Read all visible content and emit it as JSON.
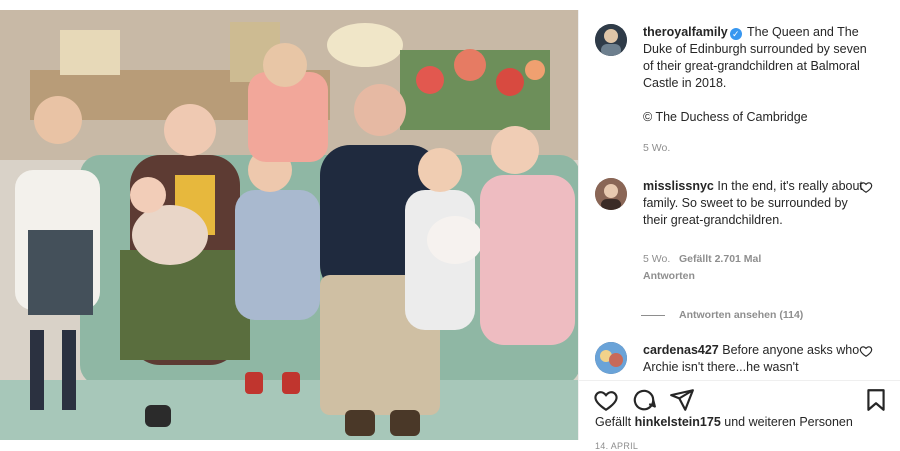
{
  "post": {
    "image_alt": "Family photo",
    "caption": {
      "username": "theroyalfamily",
      "text": "The Queen and The Duke of Edinburgh surrounded by seven of their great-grandchildren at Balmoral Castle in 2018.",
      "credit": "© The Duchess of Cambridge",
      "age": "5 Wo."
    },
    "comments": [
      {
        "username": "misslissnyc",
        "text": "In the end, it's really about family. So sweet to be surrounded by their great-grandchildren.",
        "age": "5 Wo.",
        "likes": "Gefällt 2.701 Mal",
        "reply": "Antworten",
        "view_replies": "Antworten ansehen (114)"
      },
      {
        "username": "cardenas427",
        "text": "Before anyone asks who Archie isn't there...he wasn't"
      }
    ],
    "likes_text": {
      "prefix": "Gefällt",
      "user": "hinkelstein175",
      "suffix": "und weiteren Personen"
    },
    "date": "14. APRIL"
  },
  "icons": [
    "heart-icon",
    "comment-icon",
    "share-icon",
    "bookmark-icon",
    "verified-icon"
  ],
  "colors": {
    "verified": "#3897f0",
    "meta": "#8e8e8e",
    "text": "#262626"
  }
}
